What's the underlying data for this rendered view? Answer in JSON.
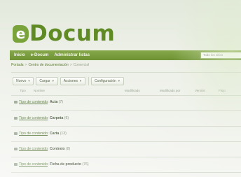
{
  "logo": {
    "mark": "e",
    "text": "Docum"
  },
  "nav": {
    "items": [
      "Inicio",
      "e-Docum",
      "Administrar listas"
    ],
    "search_placeholder": "Todo los sitios"
  },
  "breadcrumb": {
    "items": [
      "Portada",
      "Centro de documentación"
    ],
    "separator": ">",
    "current": "Comercial"
  },
  "toolbar": {
    "nuevo": "Nuevo",
    "cargar": "Cargar",
    "acciones": "Acciones",
    "configuracion": "Configuración"
  },
  "list_header": {
    "tipo": "Tipo",
    "nombre": "Nombre",
    "modificado": "Modificado",
    "modificado_por": "Modificado por",
    "version": "Versión",
    "estado": "Flujo"
  },
  "rows": [
    {
      "link": "Tipo de contenido",
      "sep": ":",
      "name": "Acta",
      "count": "(7)"
    },
    {
      "link": "Tipo de contenido",
      "sep": ":",
      "name": "Carpeta",
      "count": "(6)"
    },
    {
      "link": "Tipo de contenido",
      "sep": ":",
      "name": "Carta",
      "count": "(13)"
    },
    {
      "link": "Tipo de contenido",
      "sep": ":",
      "name": "Contrato",
      "count": "(8)"
    },
    {
      "link": "Tipo de contenido",
      "sep": ":",
      "name": "Ficha de producto",
      "count": "(76)"
    }
  ],
  "colors": {
    "brand": "#6e9233",
    "logo_mark": "#7aa33c",
    "link": "#58773a"
  }
}
